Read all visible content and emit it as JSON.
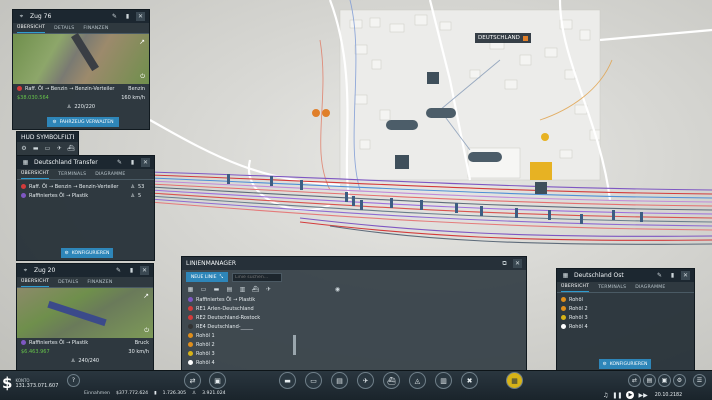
{
  "train_panel_1": {
    "title": "Zug 76",
    "tabs": [
      "ÜBERSICHT",
      "DETAILS",
      "FINANZEN"
    ],
    "route": "Raff. Öl → Benzin → Benzin-Verteiler",
    "destination": "Benzin",
    "money": "$38.030.564",
    "speed": "160 km/h",
    "capacity": "220/220",
    "manage_button": "FAHRZEUG VERWALTEN"
  },
  "hud_filter": {
    "title": "HUD SYMBOLFILTER",
    "icons": [
      "gear-icon",
      "truck-icon",
      "bus-icon",
      "plane-icon",
      "ship-icon",
      "rail-icon"
    ]
  },
  "transfer_panel": {
    "title": "Deutschland Transfer",
    "tabs": [
      "ÜBERSICHT",
      "TERMINALS",
      "DIAGRAMME"
    ],
    "rows": [
      {
        "label": "Raff. Öl → Benzin → Benzin-Verteiler",
        "count": "53",
        "color": "#d33b3b"
      },
      {
        "label": "Raffiniertes Öl → Plastik",
        "count": "5",
        "color": "#7e57c2"
      }
    ],
    "configure_button": "KONFIGURIEREN"
  },
  "train_panel_2": {
    "title": "Zug 20",
    "tabs": [
      "ÜBERSICHT",
      "DETAILS",
      "FINANZEN"
    ],
    "route": "Raffiniertes Öl → Plastik",
    "destination": "Bruck",
    "money": "$6.463.967",
    "speed": "30 km/h",
    "capacity": "240/240"
  },
  "line_manager": {
    "title": "LINIENMANAGER",
    "new_line_button": "NEUE LINIE",
    "search_placeholder": "Linie suchen...",
    "lines_top": [
      {
        "label": "Raffiniertes Öl → Plastik",
        "color": "#7e57c2"
      },
      {
        "label": "RE1 Arlen-Deutschland",
        "color": "#d33b3b"
      },
      {
        "label": "RE2 Deutschland-Rostock",
        "color": "#d33b3b"
      },
      {
        "label": "RE4 Deutschland-_____",
        "color": "#333333"
      }
    ],
    "lines_bottom": [
      {
        "label": "Rohöl 1",
        "color": "#e08e1b"
      },
      {
        "label": "Rohöl 2",
        "color": "#e08e1b"
      },
      {
        "label": "Rohöl 3",
        "color": "#d7b317"
      },
      {
        "label": "Rohöl 4",
        "color": "#ffffff"
      }
    ]
  },
  "station_panel": {
    "title": "Deutschland Ost",
    "tabs": [
      "ÜBERSICHT",
      "TERMINALS",
      "DIAGRAMME"
    ],
    "rows": [
      {
        "label": "Rohöl",
        "color": "#e08e1b"
      },
      {
        "label": "Rohöl 2",
        "color": "#e08e1b"
      },
      {
        "label": "Rohöl 3",
        "color": "#d7b317"
      },
      {
        "label": "Rohöl 4",
        "color": "#ffffff"
      }
    ],
    "configure_button": "KONFIGURIEREN"
  },
  "map": {
    "city_label": "DEUTSCHLAND"
  },
  "bottom_bar": {
    "money_label": "KONTO",
    "money_value": "131.373.071.607",
    "income_label": "Einnahmen",
    "income_value": "$377.772.624",
    "vehicles_value": "1.726.305",
    "stat_value": "3.921.024",
    "date": "20.10.2182",
    "help": "?"
  }
}
